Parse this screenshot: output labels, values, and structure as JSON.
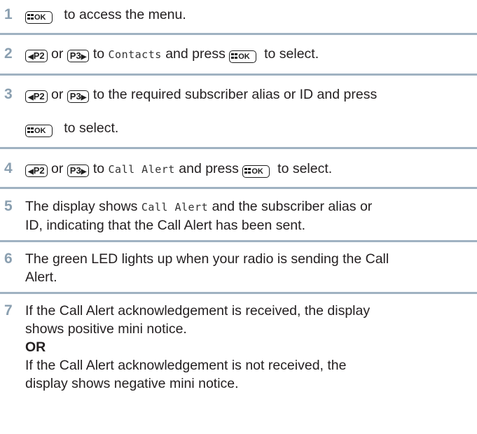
{
  "keys": {
    "menu_ok": "OK",
    "p2": "P2",
    "p3": "P3",
    "left_arrow": "◀",
    "right_arrow": "▶"
  },
  "steps": [
    {
      "num": "1",
      "text_a": "to access the menu."
    },
    {
      "num": "2",
      "or": "or",
      "to": "to",
      "menu_item": "Contacts",
      "press": "and press",
      "select": "to select."
    },
    {
      "num": "3",
      "or": "or",
      "line1": "to the required subscriber alias or ID and press",
      "line2": "to select."
    },
    {
      "num": "4",
      "or": "or",
      "to": "to",
      "menu_item": "Call Alert",
      "press": "and press",
      "select": "to select."
    },
    {
      "num": "5",
      "before": "The display shows",
      "menu_item": "Call Alert",
      "after": "and the subscriber alias or",
      "line2": "ID, indicating that the Call Alert has been sent."
    },
    {
      "num": "6",
      "line1": "The green LED lights up when your radio is sending the Call",
      "line2": "Alert."
    },
    {
      "num": "7",
      "line1": "If the Call Alert acknowledgement is received, the display",
      "line2": "shows positive mini notice.",
      "or_label": "OR",
      "line3": "If the Call Alert acknowledgement is not received, the",
      "line4": "display shows negative mini notice."
    }
  ],
  "colors": {
    "step_number": "#8a9fb0",
    "rule": "#a0b2c2"
  }
}
